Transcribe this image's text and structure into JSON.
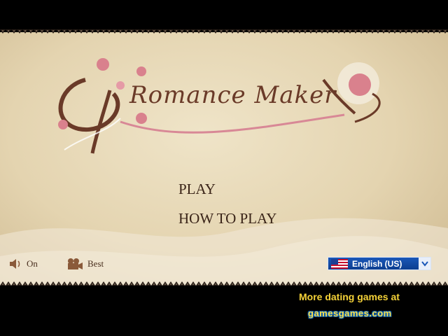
{
  "logo": {
    "title": "Romance Maker"
  },
  "menu": {
    "play": "PLAY",
    "how_to_play": "HOW TO PLAY"
  },
  "controls": {
    "sound_label": "On",
    "sound_icon": "speaker-icon",
    "quality_label": "Best",
    "quality_icon": "camera-icon"
  },
  "language": {
    "selected": "English (US)",
    "flag": "us-flag-icon"
  },
  "footer": {
    "more_games": "More dating games at",
    "brand": "gamesgames.com"
  },
  "colors": {
    "accent_blue": "#1a57b8",
    "promo_yellow": "#f5d238",
    "parchment": "#e4d4b0",
    "rose": "#d9818d"
  }
}
